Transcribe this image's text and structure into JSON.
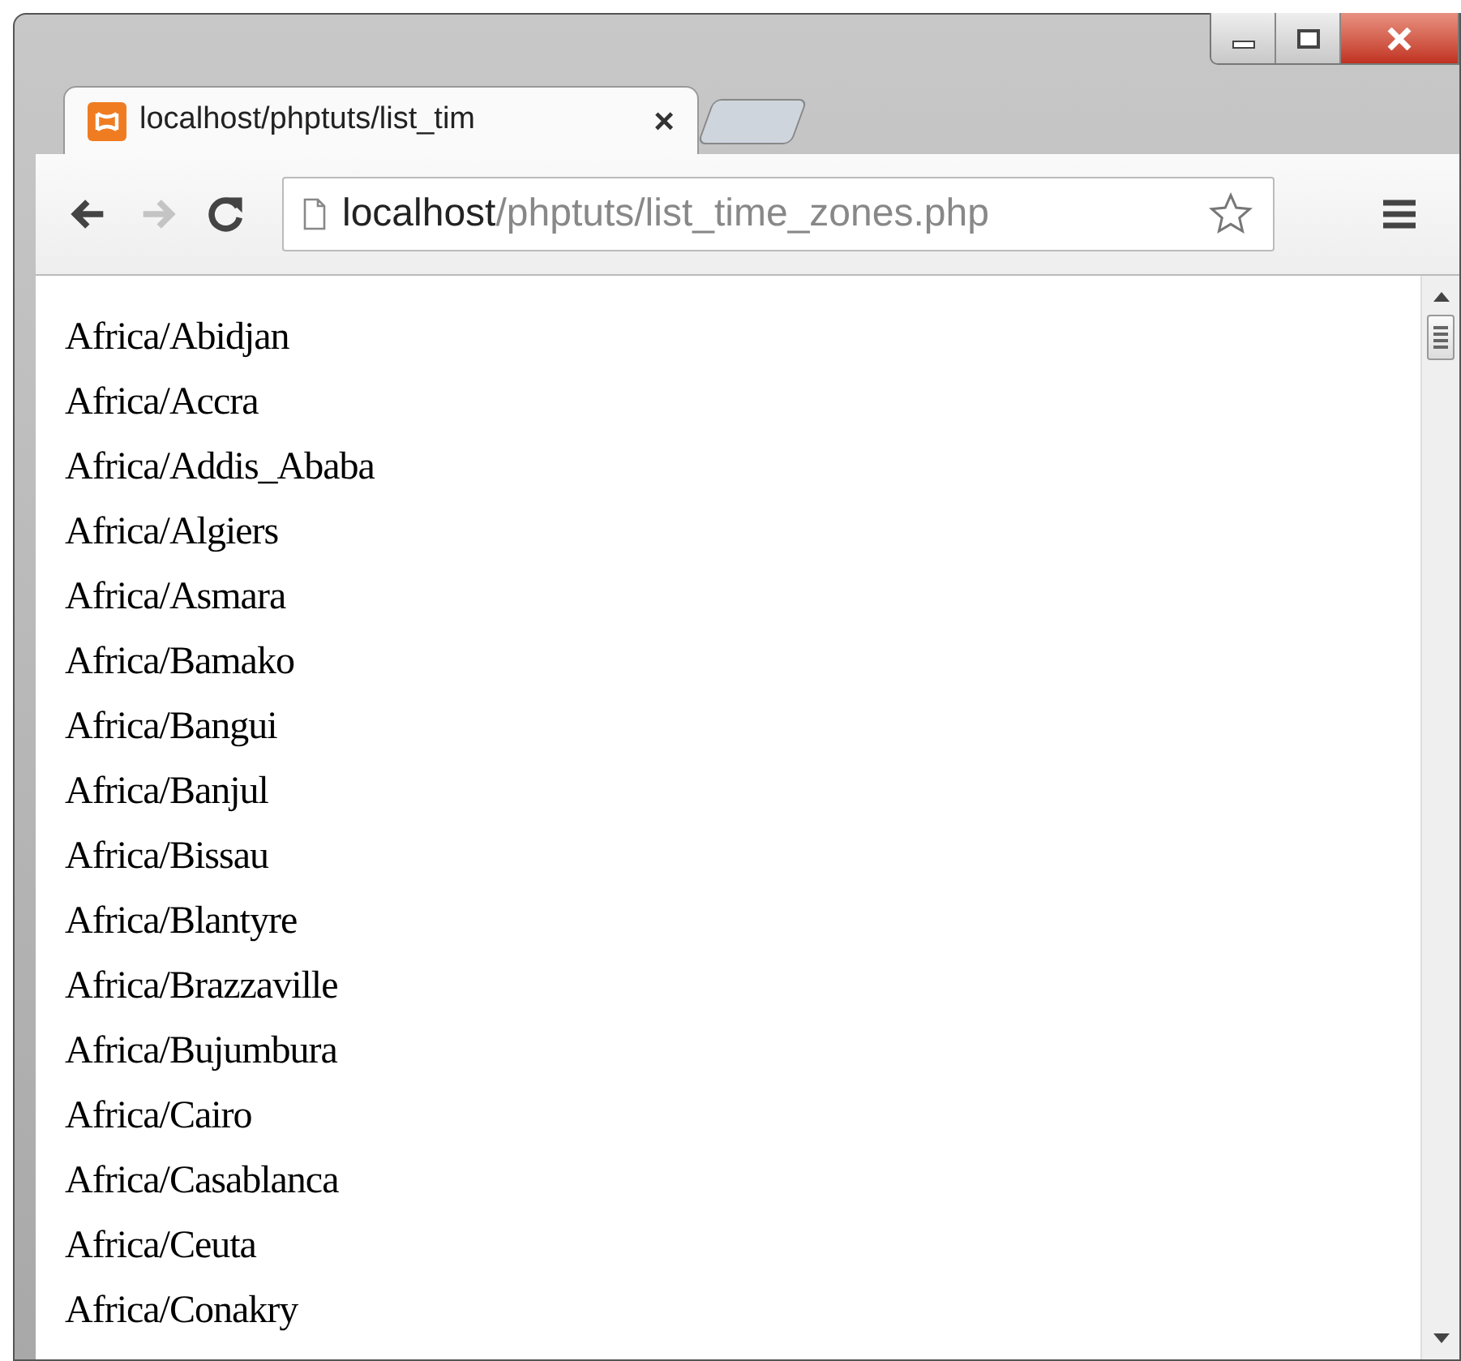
{
  "tabs": [
    {
      "title": "localhost/phptuts/list_tim",
      "close": "×",
      "selected": true
    }
  ],
  "nav_buttons": [
    {
      "kind": "back",
      "disabled": false
    },
    {
      "kind": "forward",
      "disabled": true
    },
    {
      "kind": "reload",
      "disabled": false
    }
  ],
  "address_bar": {
    "host": "localhost",
    "path": "/phptuts/list_time_zones.php"
  },
  "page_lines": [
    "Africa/Abidjan",
    "Africa/Accra",
    "Africa/Addis_Ababa",
    "Africa/Algiers",
    "Africa/Asmara",
    "Africa/Bamako",
    "Africa/Bangui",
    "Africa/Banjul",
    "Africa/Bissau",
    "Africa/Blantyre",
    "Africa/Brazzaville",
    "Africa/Bujumbura",
    "Africa/Cairo",
    "Africa/Casablanca",
    "Africa/Ceuta",
    "Africa/Conakry"
  ]
}
